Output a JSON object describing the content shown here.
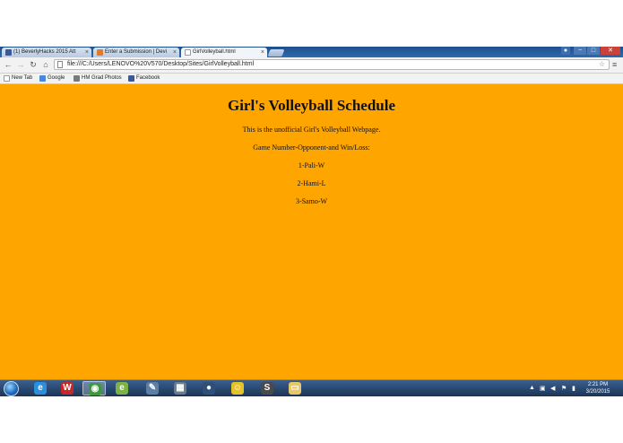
{
  "browser": {
    "tabs": [
      {
        "label": "(1) BeverlyHacks 2015 Att",
        "favicon": "facebook-icon",
        "color": "#3b5998"
      },
      {
        "label": "Enter a Submission | Devi",
        "favicon": "devpost-icon",
        "color": "#e07a2e"
      },
      {
        "label": "GirlVolleyball.html",
        "favicon": "page-icon",
        "color": "#ffffff"
      }
    ],
    "close_glyph": "×",
    "address": "file:///C:/Users/LENOVO%20V570/Desktop/Sites/GirlVolleyball.html",
    "bookmarks": [
      {
        "label": "New Tab",
        "icon": "page-icon"
      },
      {
        "label": "Google",
        "icon": "google-icon"
      },
      {
        "label": "HM Grad Photos",
        "icon": "camera-icon"
      },
      {
        "label": "Facebook",
        "icon": "facebook-icon"
      }
    ]
  },
  "page": {
    "title": "Girl's Volleyball Schedule",
    "intro": "This is the unofficial Girl's Volleyball Webpage.",
    "legend": "Game Number-Opponent-and Win/Loss:",
    "games": [
      "1-Pali-W",
      "2-Hami-L",
      "3-Samo-W"
    ],
    "background": "#FFA500"
  },
  "taskbar": {
    "apps": [
      {
        "name": "ie-icon",
        "glyph": "e",
        "color": "#2a8fdc"
      },
      {
        "name": "app-red-icon",
        "glyph": "W",
        "color": "#c62828"
      },
      {
        "name": "chrome-icon",
        "glyph": "◉",
        "color": "#3c9a3c"
      },
      {
        "name": "ie-green-icon",
        "glyph": "e",
        "color": "#7cb342"
      },
      {
        "name": "globe-tool-icon",
        "glyph": "✎",
        "color": "#5d7fa6"
      },
      {
        "name": "film-icon",
        "glyph": "▦",
        "color": "#6b7b8c"
      },
      {
        "name": "media-disc-icon",
        "glyph": "●",
        "color": "#2d4f7a"
      },
      {
        "name": "smiley-icon",
        "glyph": "☺",
        "color": "#e6c229"
      },
      {
        "name": "sublime-icon",
        "glyph": "S",
        "color": "#4a4a4a"
      },
      {
        "name": "folder-icon",
        "glyph": "▭",
        "color": "#e8c66a"
      }
    ],
    "time": "2:21 PM",
    "date": "3/20/2015"
  }
}
